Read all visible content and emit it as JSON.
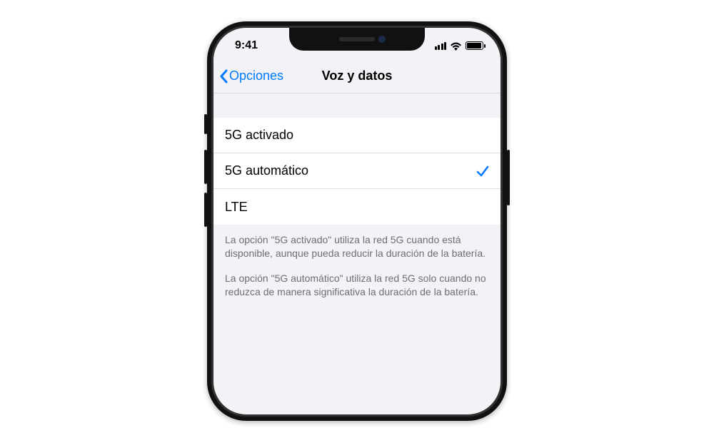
{
  "status": {
    "time": "9:41"
  },
  "nav": {
    "back_label": "Opciones",
    "title": "Voz y datos"
  },
  "options": [
    {
      "label": "5G activado",
      "selected": false
    },
    {
      "label": "5G automático",
      "selected": true
    },
    {
      "label": "LTE",
      "selected": false
    }
  ],
  "footer": {
    "p1": "La opción \"5G activado\" utiliza la red 5G cuando está disponible, aunque pueda reducir la duración de la batería.",
    "p2": "La opción \"5G automático\" utiliza la red 5G solo cuando no reduzca de manera significativa la duración de la batería."
  }
}
